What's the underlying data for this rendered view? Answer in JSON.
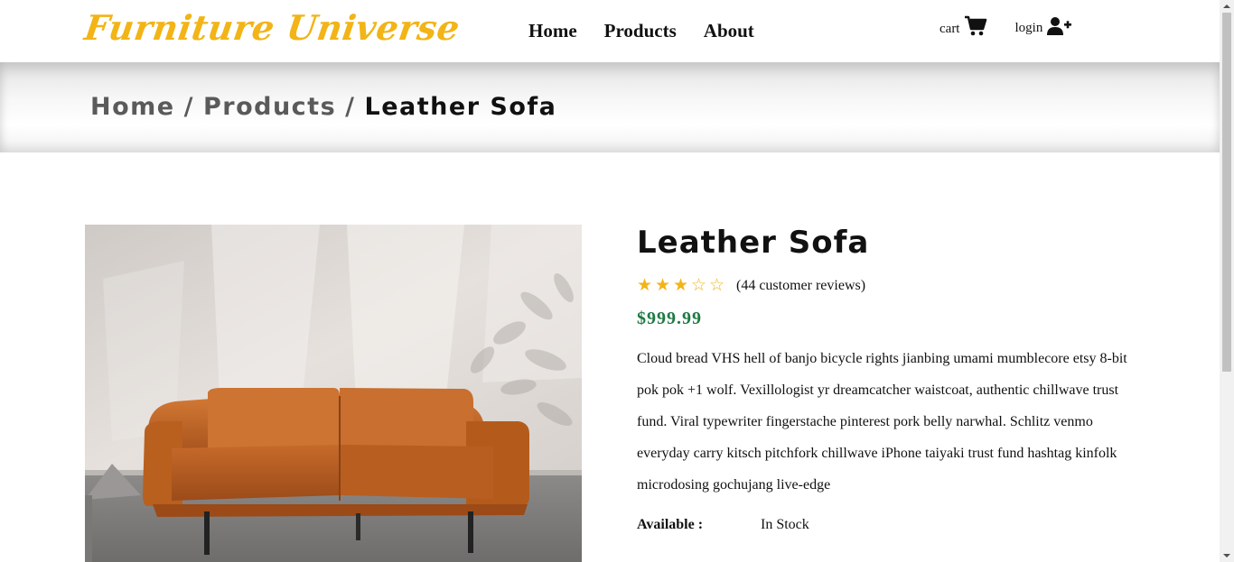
{
  "header": {
    "logo": "Furniture Universe",
    "nav": [
      "Home",
      "Products",
      "About"
    ],
    "cart_label": "cart",
    "login_label": "login"
  },
  "breadcrumb": {
    "items": [
      "Home",
      "Products"
    ],
    "separator": "/",
    "current": "Leather Sofa"
  },
  "product": {
    "title": "Leather Sofa",
    "rating": 3,
    "rating_max": 5,
    "reviews": "(44 customer reviews)",
    "price": "$999.99",
    "description": "Cloud bread VHS hell of banjo bicycle rights jianbing umami mumblecore etsy 8-bit pok pok +1 wolf. Vexillologist yr dreamcatcher waistcoat, authentic chillwave trust fund. Viral typewriter fingerstache pinterest pork belly narwhal. Schlitz venmo everyday carry kitsch pitchfork chillwave iPhone taiyaki trust fund hashtag kinfolk microdosing gochujang live-edge",
    "available_label": "Available :",
    "available_value": "In Stock"
  },
  "colors": {
    "brand": "#f2b416",
    "price": "#1f7a45",
    "sofa": "#c8692a"
  },
  "icons": {
    "cart": "shopping-cart-icon",
    "login": "user-plus-icon"
  }
}
